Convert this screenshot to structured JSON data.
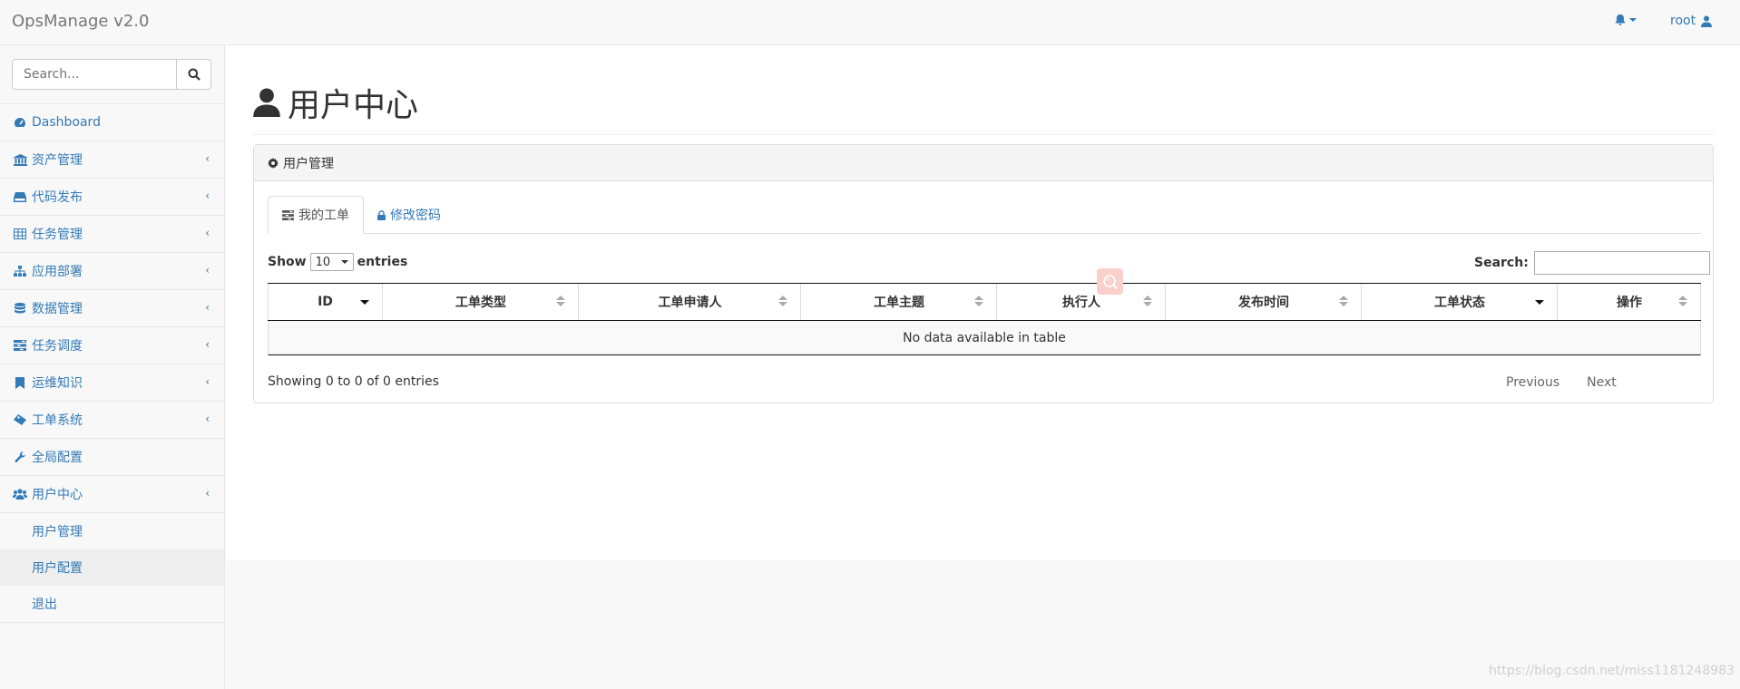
{
  "header": {
    "brand": "OpsManage v2.0",
    "username": "root"
  },
  "search": {
    "placeholder": "Search..."
  },
  "sidebar": {
    "items": [
      {
        "label": "Dashboard",
        "icon": "dashboard-icon",
        "expandable": false
      },
      {
        "label": "资产管理",
        "icon": "bank-icon",
        "expandable": true
      },
      {
        "label": "代码发布",
        "icon": "hdd-icon",
        "expandable": true
      },
      {
        "label": "任务管理",
        "icon": "table-icon",
        "expandable": true
      },
      {
        "label": "应用部署",
        "icon": "sitemap-icon",
        "expandable": true
      },
      {
        "label": "数据管理",
        "icon": "database-icon",
        "expandable": true
      },
      {
        "label": "任务调度",
        "icon": "tasks-icon",
        "expandable": true
      },
      {
        "label": "运维知识",
        "icon": "bookmark-icon",
        "expandable": true
      },
      {
        "label": "工单系统",
        "icon": "ticket-icon",
        "expandable": true
      },
      {
        "label": "全局配置",
        "icon": "wrench-icon",
        "expandable": false
      },
      {
        "label": "用户中心",
        "icon": "users-icon",
        "expandable": true
      }
    ],
    "sub_items": [
      {
        "label": "用户管理",
        "active": false
      },
      {
        "label": "用户配置",
        "active": true
      },
      {
        "label": "退出",
        "active": false
      }
    ]
  },
  "page": {
    "title": "用户中心"
  },
  "panel": {
    "heading": "用户管理",
    "tabs": [
      {
        "label": "我的工单",
        "active": true
      },
      {
        "label": "修改密码",
        "active": false
      }
    ]
  },
  "table": {
    "length_prefix": "Show",
    "length_value": "10",
    "length_suffix": "entries",
    "search_label": "Search:",
    "columns": [
      "ID",
      "工单类型",
      "工单申请人",
      "工单主题",
      "执行人",
      "发布时间",
      "工单状态",
      "操作"
    ],
    "empty_text": "No data available in table",
    "info": "Showing 0 to 0 of 0 entries",
    "prev_label": "Previous",
    "next_label": "Next"
  },
  "footer": {
    "watermark": "https://blog.csdn.net/miss1181248983"
  },
  "colors": {
    "link": "#337ab7",
    "border": "#e7e7e7"
  }
}
